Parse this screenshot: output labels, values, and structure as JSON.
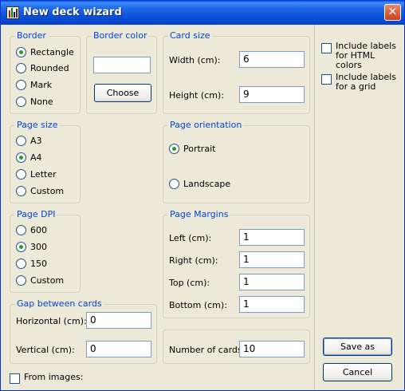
{
  "window": {
    "title": "New deck wizard"
  },
  "border": {
    "title": "Border",
    "options": [
      "Rectangle",
      "Rounded",
      "Mark",
      "None"
    ],
    "selected": "Rectangle"
  },
  "border_color": {
    "title": "Border color",
    "value": "",
    "choose_label": "Choose"
  },
  "card_size": {
    "title": "Card size",
    "width_label": "Width (cm):",
    "width_value": "6",
    "height_label": "Height (cm):",
    "height_value": "9"
  },
  "options": {
    "html_colors_label": "Include labels for HTML colors",
    "html_colors_checked": false,
    "grid_label": "Include labels for a grid",
    "grid_checked": false
  },
  "page_size": {
    "title": "Page size",
    "options": [
      "A3",
      "A4",
      "Letter",
      "Custom"
    ],
    "selected": "A4"
  },
  "page_orientation": {
    "title": "Page orientation",
    "options": [
      "Portrait",
      "Landscape"
    ],
    "selected": "Portrait"
  },
  "page_dpi": {
    "title": "Page DPI",
    "options": [
      "600",
      "300",
      "150",
      "Custom"
    ],
    "selected": "300"
  },
  "page_margins": {
    "title": "Page Margins",
    "left_label": "Left (cm):",
    "left_value": "1",
    "right_label": "Right (cm):",
    "right_value": "1",
    "top_label": "Top (cm):",
    "top_value": "1",
    "bottom_label": "Bottom (cm):",
    "bottom_value": "1"
  },
  "gap": {
    "title": "Gap between cards",
    "horizontal_label": "Horizontal (cm):",
    "horizontal_value": "0",
    "vertical_label": "Vertical (cm):",
    "vertical_value": "0"
  },
  "number_of_cards": {
    "label": "Number of cards:",
    "value": "10"
  },
  "from_images": {
    "label": "From images:",
    "checked": false
  },
  "actions": {
    "save_as_label": "Save as",
    "cancel_label": "Cancel"
  },
  "colors": {
    "accent": "#0046d5",
    "titlebar": "#0a4fd6",
    "window_bg": "#ece9d8",
    "radio_fill": "#21a121"
  }
}
